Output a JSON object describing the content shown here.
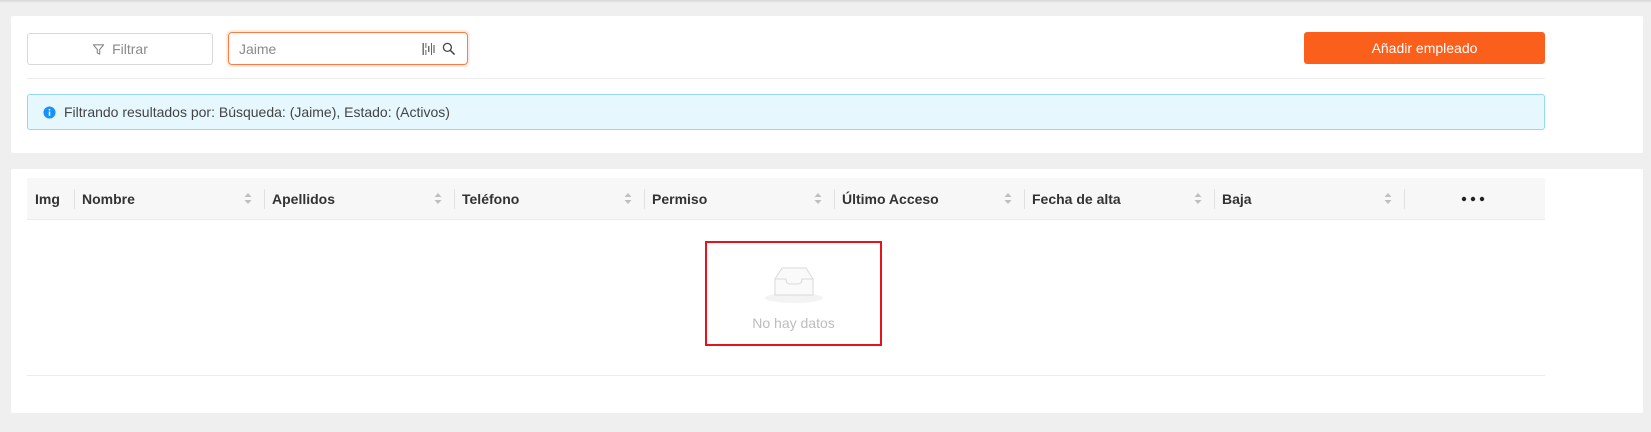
{
  "toolbar": {
    "filter_label": "Filtrar",
    "search_value": "Jaime",
    "add_label": "Añadir empleado"
  },
  "alert": {
    "text": "Filtrando resultados por: Búsqueda: (Jaime), Estado: (Activos)"
  },
  "table": {
    "columns": [
      "Img",
      "Nombre",
      "Apellidos",
      "Teléfono",
      "Permiso",
      "Último Acceso",
      "Fecha de alta",
      "Baja"
    ],
    "empty_text": "No hay datos"
  },
  "colors": {
    "accent": "#fa5f1b",
    "alert_bg": "#e6f7fe",
    "info_blue": "#1890ff",
    "highlight_red": "#e8131a"
  }
}
